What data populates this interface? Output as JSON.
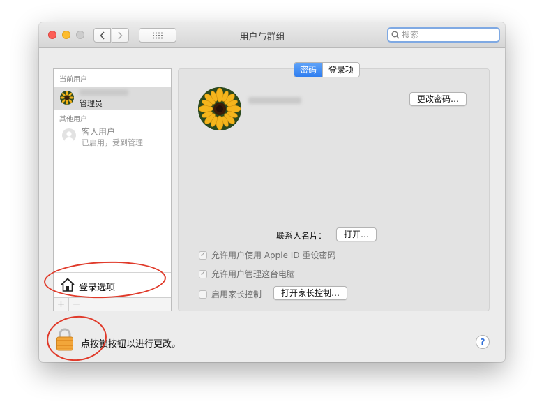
{
  "window": {
    "title": "用户与群组",
    "search_placeholder": "搜索"
  },
  "sidebar": {
    "current_users_header": "当前用户",
    "current_user_role": "管理员",
    "other_users_header": "其他用户",
    "guest_name": "客人用户",
    "guest_status": "已启用，受到管理",
    "login_options_label": "登录选项",
    "add_label": "+",
    "remove_label": "−"
  },
  "tabs": [
    {
      "label": "密码",
      "active": true
    },
    {
      "label": "登录项",
      "active": false
    }
  ],
  "main": {
    "change_password_label": "更改密码…",
    "contact_card_label": "联系人名片：",
    "open_label": "打开…",
    "allow_reset_label": "允许用户使用 Apple ID 重设密码",
    "allow_reset_checked": true,
    "allow_admin_label": "允许用户管理这台电脑",
    "allow_admin_checked": true,
    "parental_label": "启用家长控制",
    "parental_checked": false,
    "open_parental_label": "打开家长控制…"
  },
  "footer": {
    "lock_text": "点按锁按钮以进行更改。",
    "help_label": "?"
  },
  "colors": {
    "annotation": "#e03a2a",
    "tab_active": "#2f7ef0"
  },
  "icons": [
    "back-chevron-icon",
    "forward-chevron-icon",
    "grid-icon",
    "search-icon",
    "house-icon",
    "lock-icon",
    "help-icon"
  ]
}
